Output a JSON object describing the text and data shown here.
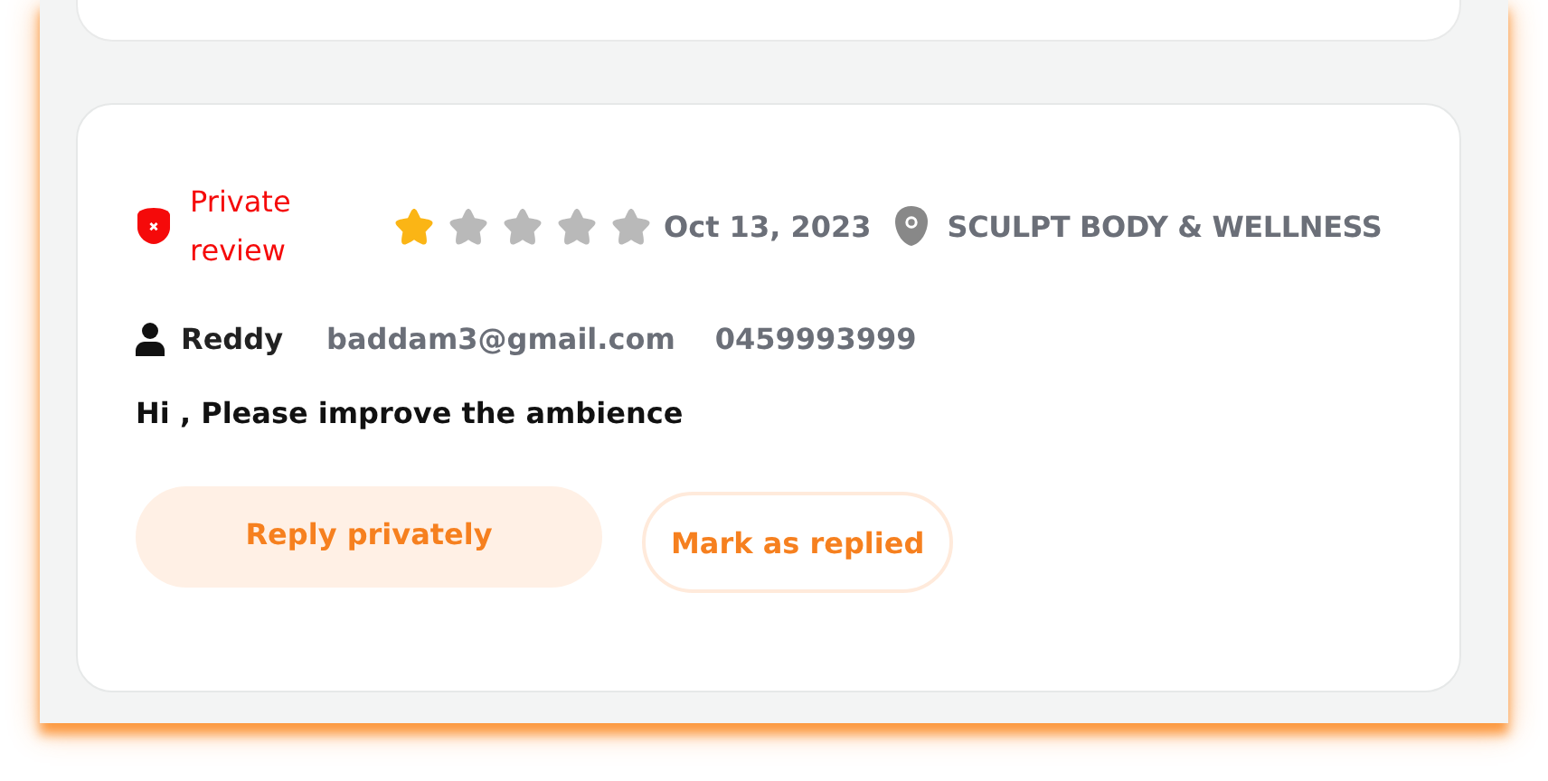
{
  "review": {
    "private_label": "Private review",
    "stars": 1,
    "date": "Oct 13, 2023",
    "location": "SCULPT BODY & WELLNESS",
    "reviewer": "Reddy",
    "email": "baddam3@gmail.com",
    "phone": "0459993999",
    "message": "Hi , Please improve the ambience",
    "buttons": [
      {
        "label": "Reply privately",
        "kind": "primary"
      },
      {
        "label": "Mark as replied",
        "kind": "outline"
      }
    ]
  }
}
